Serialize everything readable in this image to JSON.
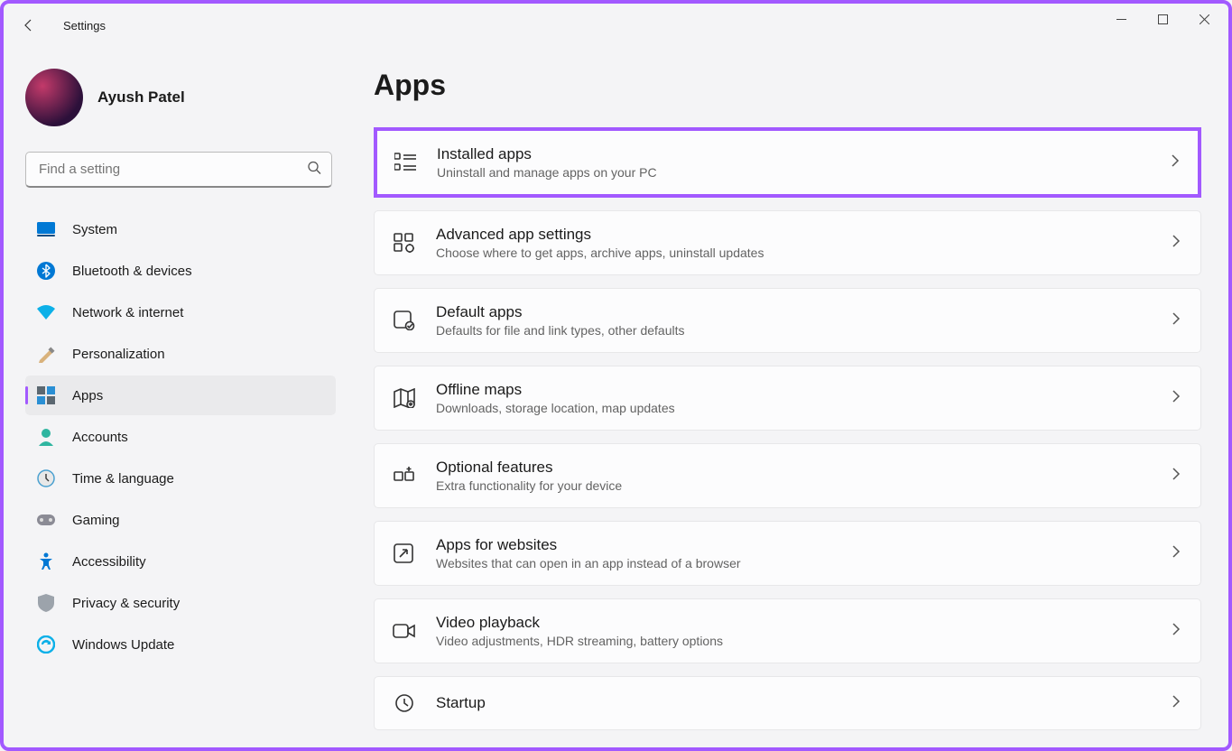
{
  "window": {
    "title": "Settings"
  },
  "profile": {
    "name": "Ayush Patel"
  },
  "search": {
    "placeholder": "Find a setting"
  },
  "sidebar": {
    "items": [
      {
        "label": "System"
      },
      {
        "label": "Bluetooth & devices"
      },
      {
        "label": "Network & internet"
      },
      {
        "label": "Personalization"
      },
      {
        "label": "Apps"
      },
      {
        "label": "Accounts"
      },
      {
        "label": "Time & language"
      },
      {
        "label": "Gaming"
      },
      {
        "label": "Accessibility"
      },
      {
        "label": "Privacy & security"
      },
      {
        "label": "Windows Update"
      }
    ]
  },
  "page": {
    "title": "Apps"
  },
  "cards": [
    {
      "title": "Installed apps",
      "sub": "Uninstall and manage apps on your PC"
    },
    {
      "title": "Advanced app settings",
      "sub": "Choose where to get apps, archive apps, uninstall updates"
    },
    {
      "title": "Default apps",
      "sub": "Defaults for file and link types, other defaults"
    },
    {
      "title": "Offline maps",
      "sub": "Downloads, storage location, map updates"
    },
    {
      "title": "Optional features",
      "sub": "Extra functionality for your device"
    },
    {
      "title": "Apps for websites",
      "sub": "Websites that can open in an app instead of a browser"
    },
    {
      "title": "Video playback",
      "sub": "Video adjustments, HDR streaming, battery options"
    },
    {
      "title": "Startup",
      "sub": ""
    }
  ]
}
